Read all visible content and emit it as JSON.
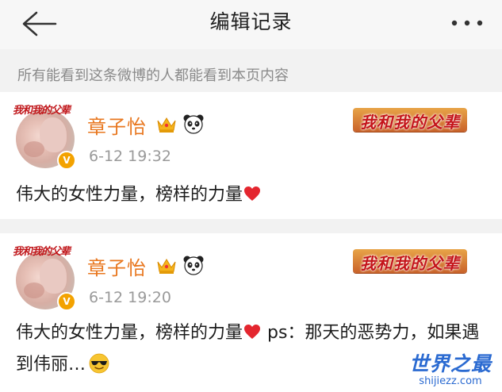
{
  "nav": {
    "title": "编辑记录",
    "back_icon": "arrow-left-icon",
    "more_icon": "more-dots-icon"
  },
  "notice": "所有能看到这条微博的人都能看到本页内容",
  "posts": [
    {
      "avatar_logo": "我和我的父辈",
      "verified_mark": "V",
      "user": "章子怡",
      "badges": [
        "crown-icon",
        "panda-icon"
      ],
      "time": "6-12 19:32",
      "banner": "我和我的父辈",
      "text": "伟大的女性力量，榜样的力量"
    },
    {
      "avatar_logo": "我和我的父辈",
      "verified_mark": "V",
      "user": "章子怡",
      "badges": [
        "crown-icon",
        "panda-icon"
      ],
      "time": "6-12 19:20",
      "banner": "我和我的父辈",
      "text": "伟大的女性力量，榜样的力量",
      "text_after": " ps：那天的恶势力，如果遇到伟丽…"
    }
  ],
  "watermark": {
    "title": "世界之最",
    "url": "shijiezz.com"
  },
  "colors": {
    "accent": "#e8771f",
    "heart": "#e4262f",
    "time": "#9a9a9a",
    "watermark": "#2a6ad1"
  }
}
